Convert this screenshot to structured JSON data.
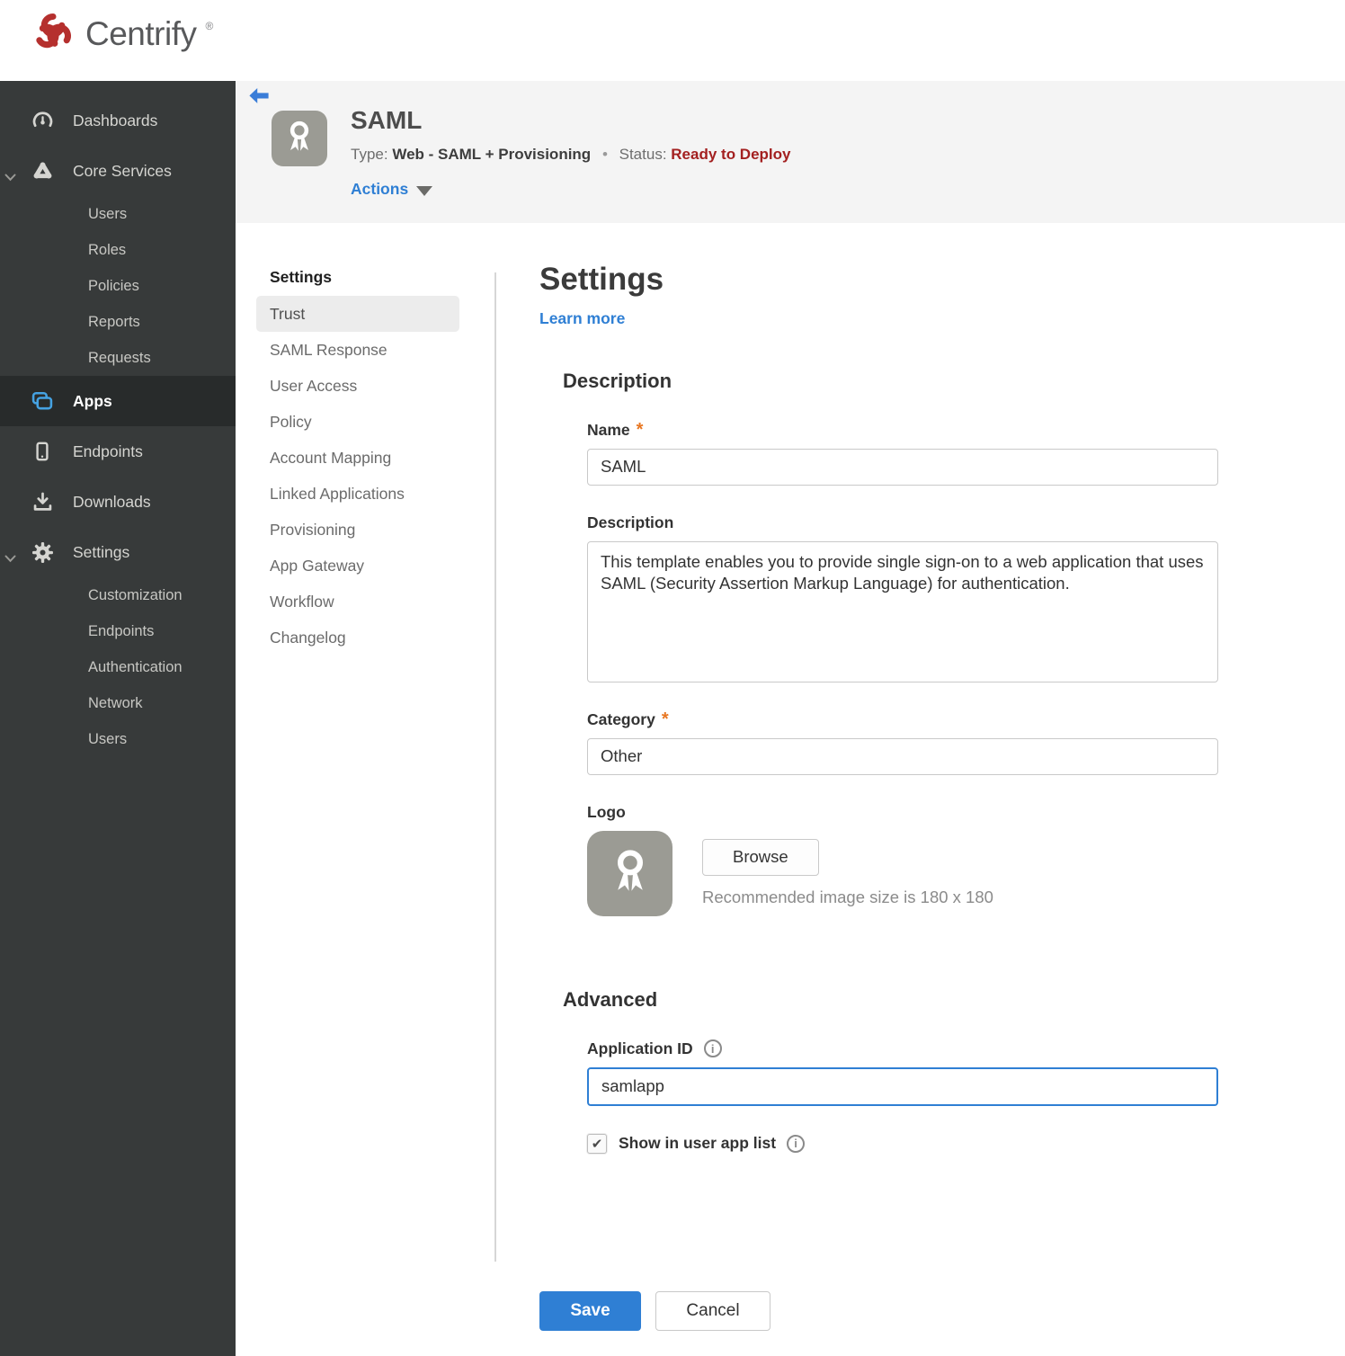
{
  "brand": {
    "name": "Centrify",
    "reg": "®"
  },
  "glyphs": {
    "info": "i",
    "check": "✔"
  },
  "sidebar": {
    "items": [
      {
        "label": "Dashboards"
      },
      {
        "label": "Core Services"
      },
      {
        "label": "Users"
      },
      {
        "label": "Roles"
      },
      {
        "label": "Policies"
      },
      {
        "label": "Reports"
      },
      {
        "label": "Requests"
      },
      {
        "label": "Apps"
      },
      {
        "label": "Endpoints"
      },
      {
        "label": "Downloads"
      },
      {
        "label": "Settings"
      },
      {
        "label": "Customization"
      },
      {
        "label": "Endpoints"
      },
      {
        "label": "Authentication"
      },
      {
        "label": "Network"
      },
      {
        "label": "Users"
      }
    ]
  },
  "header": {
    "title": "SAML",
    "type_label": "Type:",
    "type_value": "Web - SAML + Provisioning",
    "separator": "•",
    "status_label": "Status:",
    "status_value": "Ready to Deploy",
    "actions_label": "Actions"
  },
  "subnav": {
    "header": "Settings",
    "items": [
      {
        "label": "Trust"
      },
      {
        "label": "SAML Response"
      },
      {
        "label": "User Access"
      },
      {
        "label": "Policy"
      },
      {
        "label": "Account Mapping"
      },
      {
        "label": "Linked Applications"
      },
      {
        "label": "Provisioning"
      },
      {
        "label": "App Gateway"
      },
      {
        "label": "Workflow"
      },
      {
        "label": "Changelog"
      }
    ]
  },
  "main": {
    "title": "Settings",
    "learn_more": "Learn more",
    "description": {
      "heading": "Description",
      "name_label": "Name",
      "required": "*",
      "name_value": "SAML",
      "desc_label": "Description",
      "desc_value": "This template enables you to provide single sign-on to a web application that uses SAML (Security Assertion Markup Language) for authentication.",
      "category_label": "Category",
      "category_value": "Other",
      "logo_label": "Logo",
      "browse_label": "Browse",
      "logo_hint": "Recommended image size is 180 x 180"
    },
    "advanced": {
      "heading": "Advanced",
      "app_id_label": "Application ID",
      "app_id_value": "samlapp",
      "show_label": "Show in user app list"
    },
    "footer": {
      "save": "Save",
      "cancel": "Cancel"
    }
  },
  "colors": {
    "accent_blue": "#2f7fd4",
    "status_red": "#a32020",
    "asterisk_orange": "#e87722",
    "sidebar_bg": "#373a3a",
    "sidebar_active_bg": "#282b2b",
    "apps_icon_blue": "#45a2e2",
    "brand_red": "#b5302e",
    "header_bg": "#f4f4f4",
    "logo_tile_gray": "#9b9b94"
  }
}
